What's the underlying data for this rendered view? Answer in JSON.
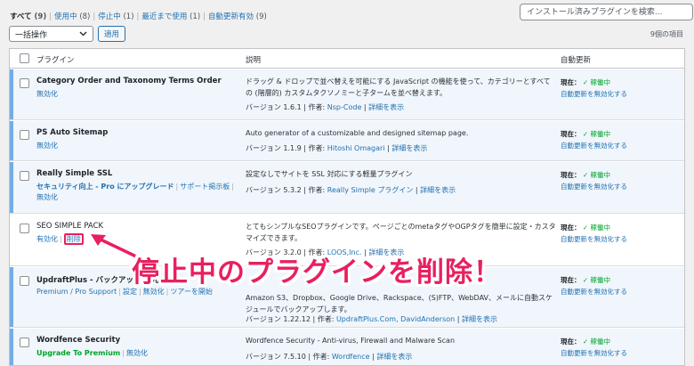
{
  "filters": {
    "all": {
      "label": "すべて",
      "count": "(9)"
    },
    "active": {
      "label": "使用中",
      "count": "(8)"
    },
    "inactive": {
      "label": "停止中",
      "count": "(1)"
    },
    "recent": {
      "label": "最近まで使用",
      "count": "(1)"
    },
    "auto": {
      "label": "自動更新有効",
      "count": "(9)"
    }
  },
  "search": {
    "placeholder": "インストール済みプラグインを検索..."
  },
  "bulk": {
    "selected": "一括操作",
    "apply_label": "適用"
  },
  "item_count": "9個の項目",
  "columns": {
    "plugin": "プラグイン",
    "description": "説明",
    "auto_update": "自動更新"
  },
  "plugins": [
    {
      "name": "Category Order and Taxonomy Terms Order",
      "actions": [
        "無効化"
      ],
      "description": "ドラッグ & ドロップで並べ替えを可能にする JavaScript の機能を使って、カテゴリーとすべての (階層的) カスタムタクソノミーと子タームを並べ替えます。",
      "version": "バージョン 1.6.1",
      "author_label": "作者:",
      "author": "Nsp-Code",
      "details": "詳細を表示",
      "auto_status": "現在：",
      "auto_state": "✓ 稼働中",
      "auto_link": "自動更新を無効化する"
    },
    {
      "name": "PS Auto Sitemap",
      "actions": [
        "無効化"
      ],
      "description": "Auto generator of a customizable and designed sitemap page.",
      "version": "バージョン 1.1.9",
      "author_label": "作者:",
      "author": "Hitoshi Omagari",
      "details": "詳細を表示",
      "auto_status": "現在：",
      "auto_state": "✓ 稼働中",
      "auto_link": "自動更新を無効化する"
    },
    {
      "name": "Really Simple SSL",
      "actions": [
        "セキュリティ向上 - Pro にアップグレード",
        "サポート掲示板",
        "無効化"
      ],
      "description": "設定なしでサイトを SSL 対応にする軽量プラグイン",
      "version": "バージョン 5.3.2",
      "author_label": "作者:",
      "author": "Really Simple プラグイン",
      "details": "詳細を表示",
      "auto_status": "現在：",
      "auto_state": "✓ 稼働中",
      "auto_link": "自動更新を無効化する"
    },
    {
      "name": "SEO SIMPLE PACK",
      "actions": [
        "有効化",
        "削除"
      ],
      "description": "とてもシンプルなSEOプラグインです。ページごとのmetaタグやOGPタグを簡単に設定・カスタマイズできます。",
      "version": "バージョン 3.2.0",
      "author_label": "作者:",
      "author": "LOOS,Inc.",
      "details": "詳細を表示",
      "auto_status": "現在：",
      "auto_state": "✓ 稼働中",
      "auto_link": "自動更新を無効化する"
    },
    {
      "name": "UpdraftPlus - バックアップ/復元",
      "actions": [
        "Premium / Pro Support",
        "設定",
        "無効化",
        "ツアーを開始"
      ],
      "description": "Amazon S3、Dropbox、Google Drive、Rackspace、(S)FTP、WebDAV、メールに自動スケジュールでバックアップします。",
      "version": "バージョン 1.22.12",
      "author_label": "作者:",
      "author": "UpdraftPlus.Com, DavidAnderson",
      "details": "詳細を表示",
      "auto_status": "現在：",
      "auto_state": "✓ 稼働中",
      "auto_link": "自動更新を無効化する"
    },
    {
      "name": "Wordfence Security",
      "actions": [
        "Upgrade To Premium",
        "無効化"
      ],
      "description": "Wordfence Security - Anti-virus, Firewall and Malware Scan",
      "version": "バージョン 7.5.10",
      "author_label": "作者:",
      "author": "Wordfence",
      "details": "詳細を表示",
      "auto_status": "現在：",
      "auto_state": "✓ 稼働中",
      "auto_link": "自動更新を無効化する"
    }
  ],
  "annotation": "停止中のプラグインを削除！",
  "colors": {
    "link": "#2271b1",
    "active_bar": "#72aee6",
    "active_bg": "#f0f6fc",
    "green": "#00a32a",
    "annotation": "#e8205f"
  }
}
